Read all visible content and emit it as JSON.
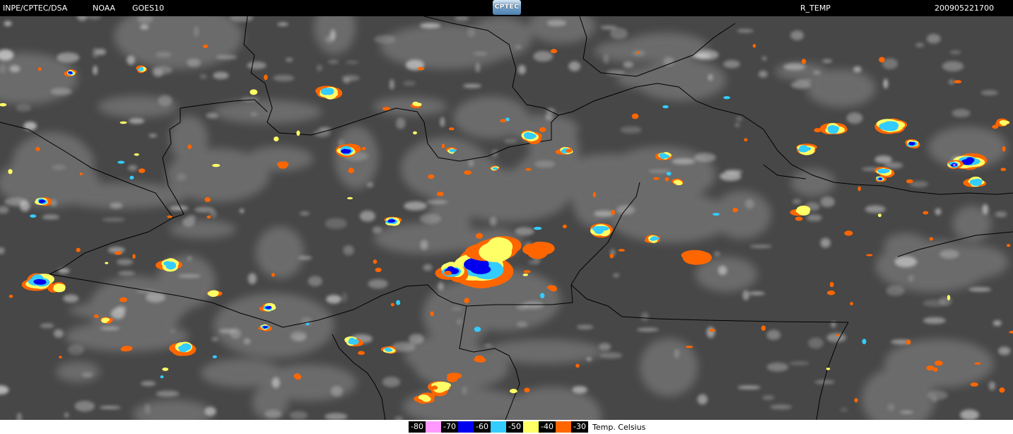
{
  "header": {
    "source": "INPE/CPTEC/DSA",
    "agency": "NOAA",
    "satellite": "GOES10",
    "logo_text": "CPTEC",
    "product": "R_TEMP",
    "datetime": "200905221700"
  },
  "legend": {
    "items": [
      {
        "label": "-80",
        "color": "#ff99ff"
      },
      {
        "label": "-70",
        "color": "#0000ee"
      },
      {
        "label": "-60",
        "color": "#33ccff"
      },
      {
        "label": "-50",
        "color": "#ffff66"
      },
      {
        "label": "-40",
        "color": "#ff6600"
      },
      {
        "label": "-30",
        "color": ""
      }
    ],
    "units": "Temp. Celsius"
  },
  "colors": {
    "background": "#4a4a4a",
    "cloud": "#cfcfcf",
    "border": "#000000"
  }
}
